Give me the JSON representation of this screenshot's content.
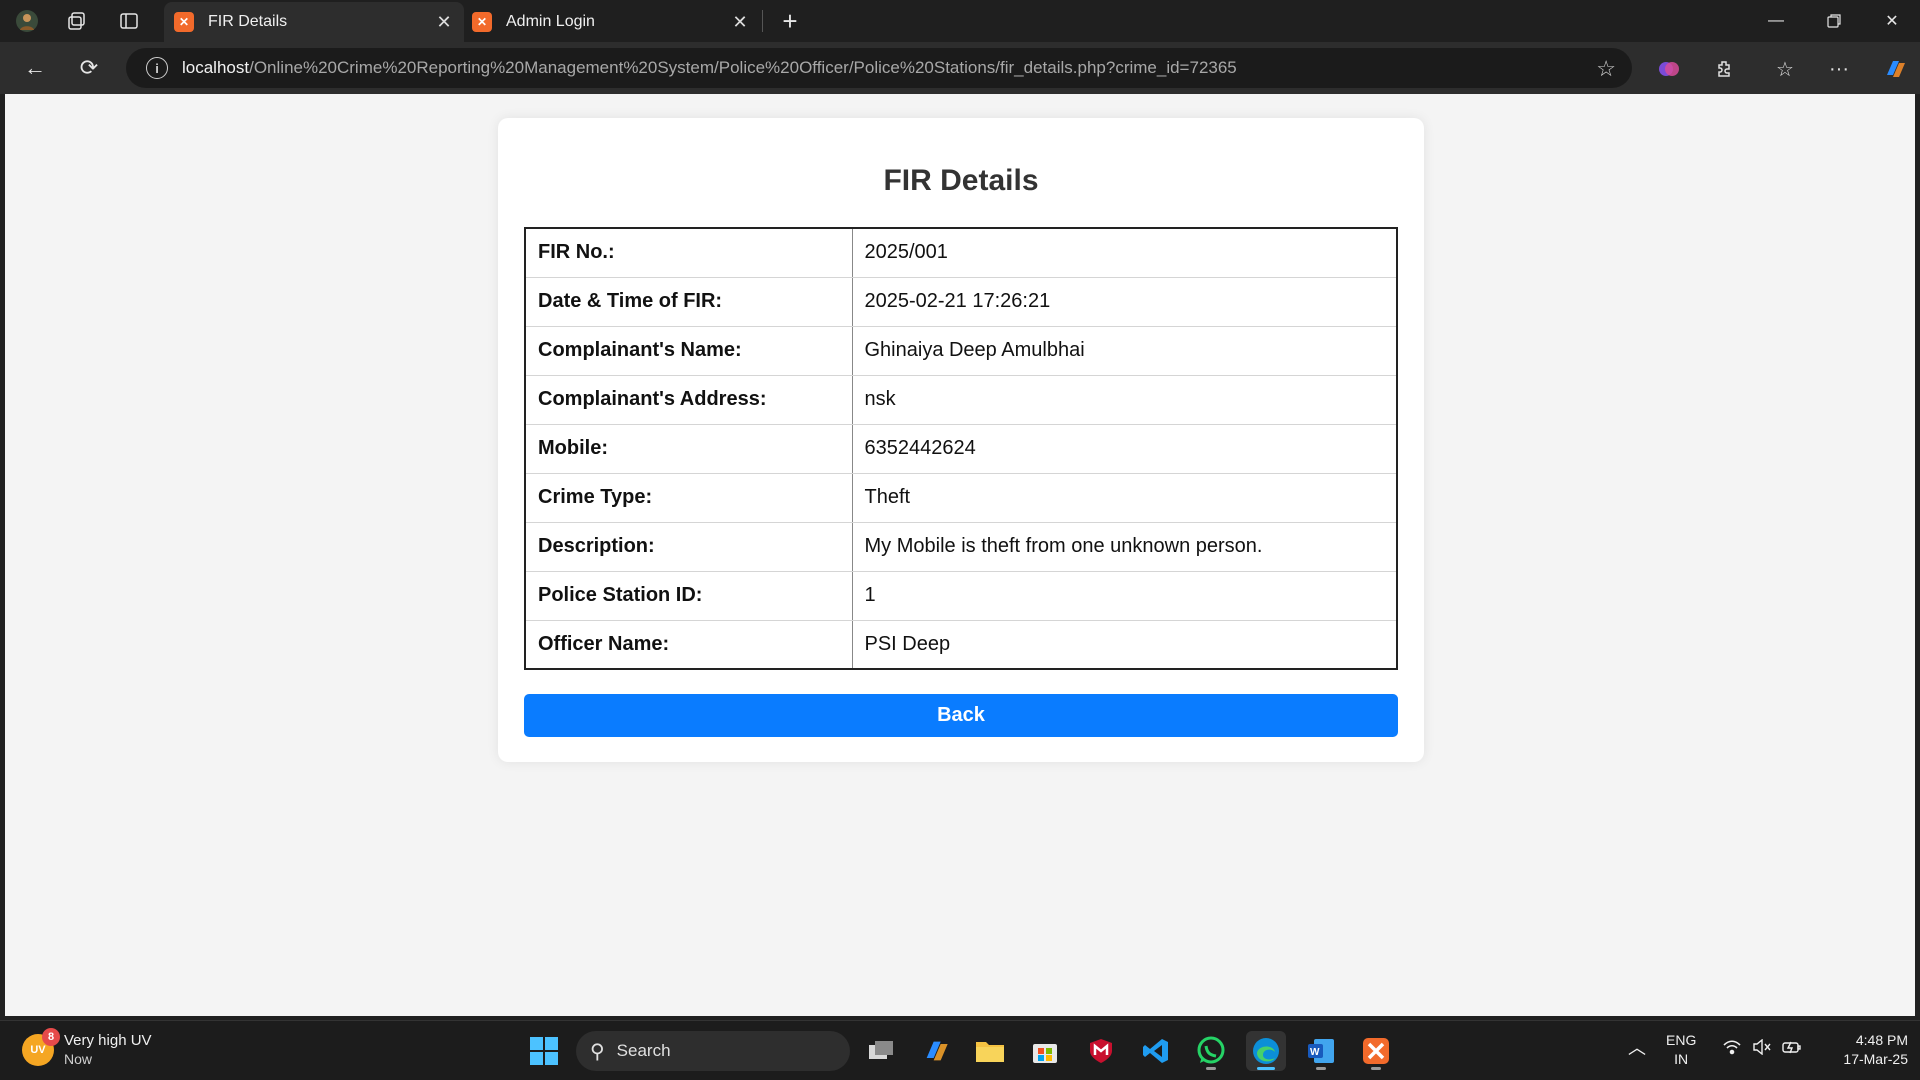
{
  "browser": {
    "tabs": [
      {
        "label": "FIR Details",
        "favicon": "xampp-icon",
        "active": true
      },
      {
        "label": "Admin Login",
        "favicon": "xampp-icon",
        "active": false
      }
    ],
    "url_host": "localhost",
    "url_path": "/Online%20Crime%20Reporting%20Management%20System/Police%20Officer/Police%20Stations/fir_details.php?crime_id=72365"
  },
  "page": {
    "title": "FIR Details",
    "rows": [
      {
        "label": "FIR No.:",
        "value": "2025/001"
      },
      {
        "label": "Date & Time of FIR:",
        "value": "2025-02-21 17:26:21"
      },
      {
        "label": "Complainant's Name:",
        "value": "Ghinaiya Deep Amulbhai"
      },
      {
        "label": "Complainant's Address:",
        "value": "nsk"
      },
      {
        "label": "Mobile:",
        "value": "6352442624"
      },
      {
        "label": "Crime Type:",
        "value": "Theft"
      },
      {
        "label": "Description:",
        "value": "My Mobile is theft from one unknown person."
      },
      {
        "label": "Police Station ID:",
        "value": "1"
      },
      {
        "label": "Officer Name:",
        "value": "PSI Deep"
      }
    ],
    "back_label": "Back",
    "accent_color": "#0a7cff"
  },
  "taskbar": {
    "weather_badge": "UV",
    "weather_count": "8",
    "weather_title": "Very high UV",
    "weather_sub": "Now",
    "search_placeholder": "Search",
    "lang_top": "ENG",
    "lang_bottom": "IN",
    "time": "4:48 PM",
    "date": "17-Mar-25"
  }
}
